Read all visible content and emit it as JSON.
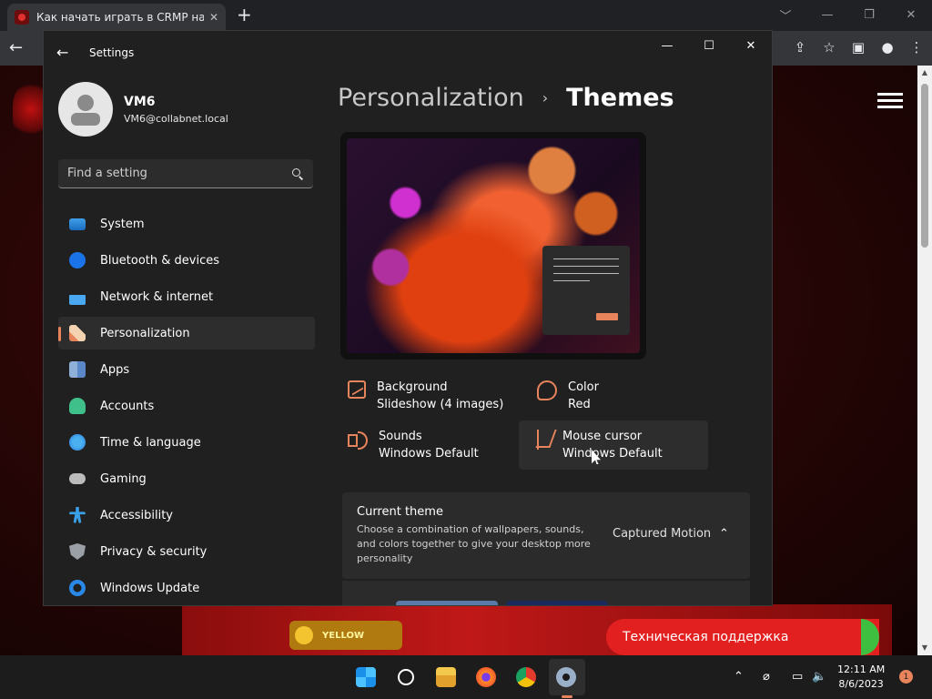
{
  "browser": {
    "tab_title": "Как начать играть в CRMP на Android",
    "tab_close": "✕",
    "new_tab": "+",
    "min": "﹀",
    "restore": "—",
    "max": "❐",
    "close": "✕",
    "back": "←",
    "icons": [
      "⇪",
      "☆",
      "▣",
      "●",
      "⋮"
    ]
  },
  "site": {
    "badge": "YELLOW",
    "support": "Техническая поддержка"
  },
  "settings": {
    "title": "Settings",
    "back": "←",
    "min": "—",
    "max": "☐",
    "close": "✕",
    "user": {
      "name": "VM6",
      "email": "VM6@collabnet.local"
    },
    "search_placeholder": "Find a setting",
    "nav": [
      {
        "label": "System",
        "icon": "system-icon"
      },
      {
        "label": "Bluetooth & devices",
        "icon": "bluetooth-icon"
      },
      {
        "label": "Network & internet",
        "icon": "wifi-icon"
      },
      {
        "label": "Personalization",
        "icon": "brush-icon",
        "active": true
      },
      {
        "label": "Apps",
        "icon": "apps-icon"
      },
      {
        "label": "Accounts",
        "icon": "person-icon"
      },
      {
        "label": "Time & language",
        "icon": "globe-icon"
      },
      {
        "label": "Gaming",
        "icon": "gamepad-icon"
      },
      {
        "label": "Accessibility",
        "icon": "accessibility-icon"
      },
      {
        "label": "Privacy & security",
        "icon": "shield-icon"
      },
      {
        "label": "Windows Update",
        "icon": "update-icon"
      }
    ],
    "breadcrumb": {
      "parent": "Personalization",
      "sep": "›",
      "current": "Themes"
    },
    "tiles": {
      "background": {
        "label": "Background",
        "value": "Slideshow (4 images)"
      },
      "color": {
        "label": "Color",
        "value": "Red"
      },
      "sounds": {
        "label": "Sounds",
        "value": "Windows Default"
      },
      "cursor": {
        "label": "Mouse cursor",
        "value": "Windows Default"
      }
    },
    "current_theme": {
      "title": "Current theme",
      "description": "Choose a combination of wallpapers, sounds, and colors together to give your desktop more personality",
      "value": "Captured Motion",
      "chevron": "⌃"
    },
    "accent": "#e8845c"
  },
  "taskbar": {
    "apps": [
      "start-icon",
      "search-icon",
      "file-explorer-icon",
      "firefox-icon",
      "chrome-icon",
      "settings-icon"
    ],
    "tray": {
      "chevron": "⌃",
      "network": "⌀",
      "display": "▭",
      "volume": "🔈"
    },
    "time": "12:11 AM",
    "date": "8/6/2023",
    "notifications": "1"
  }
}
